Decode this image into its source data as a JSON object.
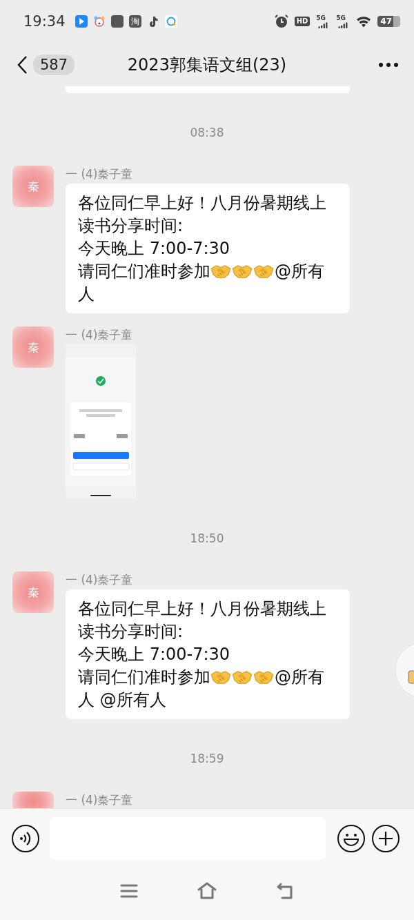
{
  "status_bar": {
    "time": "19:34",
    "notification_icons": [
      {
        "kind": "arrow"
      },
      {
        "kind": "pet"
      },
      {
        "kind": "square"
      },
      {
        "kind": "char",
        "text": "淘"
      },
      {
        "kind": "note"
      },
      {
        "kind": "chat"
      }
    ],
    "networks": [
      "5G",
      "5G"
    ],
    "hd": "HD",
    "battery": "47"
  },
  "header": {
    "unread": "587",
    "title": "2023郭集语文组(23)"
  },
  "chat": [
    {
      "kind": "partial_bubble"
    },
    {
      "kind": "time",
      "text": "08:38"
    },
    {
      "kind": "message",
      "avatar": "秦",
      "sender": "一 (4)秦子童",
      "parts": [
        {
          "kind": "text",
          "text": "各位同仁早上好！八月份暑期线上读书分享时间:\n今天晚上 7:00-7:30\n请同仁们准时参加"
        },
        {
          "kind": "emoji"
        },
        {
          "kind": "emoji"
        },
        {
          "kind": "emoji"
        },
        {
          "kind": "text",
          "text": "@所有人"
        }
      ]
    },
    {
      "avatar": "秦",
      "sender": "一 (4)秦子童"
    },
    {
      "kind": "time",
      "text": "18:50"
    },
    {
      "kind": "message",
      "avatar": "秦",
      "sender": "一 (4)秦子童",
      "parts": [
        {
          "kind": "text",
          "text": "各位同仁早上好！八月份暑期线上读书分享时间:\n今天晚上 7:00-7:30\n请同仁们准时参加"
        },
        {
          "kind": "emoji"
        },
        {
          "kind": "emoji"
        },
        {
          "kind": "emoji"
        },
        {
          "kind": "text",
          "text": "@所有人 @所有人"
        }
      ]
    },
    {
      "kind": "time",
      "text": "18:59"
    },
    {
      "kind": "cut_message",
      "sender": "一 (4)秦子童"
    }
  ]
}
